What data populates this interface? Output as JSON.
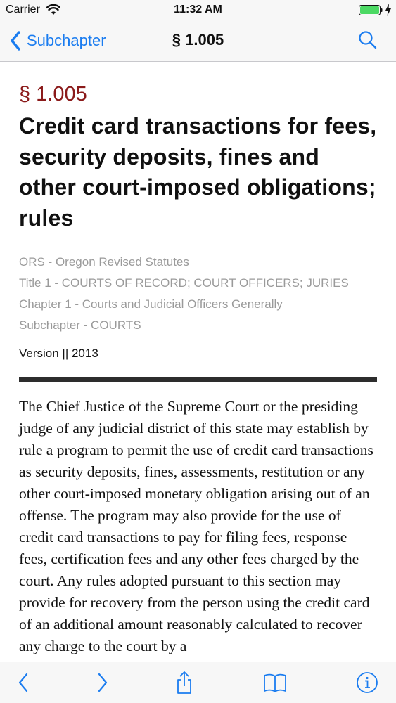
{
  "status_bar": {
    "carrier": "Carrier",
    "time": "11:32 AM"
  },
  "nav": {
    "back_label": "Subchapter",
    "title": "§ 1.005",
    "accent_color": "#1a7cf0"
  },
  "section": {
    "number": "§ 1.005",
    "title": "Credit card transactions for fees, security deposits, fines and other court-imposed obligations; rules",
    "number_color": "#8b1a1a"
  },
  "meta": {
    "lines": [
      "ORS - Oregon Revised Statutes",
      "Title 1 - COURTS OF RECORD; COURT OFFICERS; JURIES",
      "Chapter 1 - Courts and Judicial Officers Generally",
      "Subchapter - COURTS"
    ],
    "version": "Version || 2013"
  },
  "body": {
    "text": "The Chief Justice of the Supreme Court or the presiding judge of any judicial district of this state may establish by rule a program to permit the use of credit card transactions as security deposits, fines, assessments, restitution or any other court-imposed monetary obligation arising out of an offense. The program may also provide for the use of credit card transactions to pay for filing fees, response fees, certification fees and any other fees charged by the court. Any rules adopted pursuant to this section may provide for recovery from the person using the credit card of an additional amount reasonably calculated to recover any charge to the court by a"
  },
  "toolbar": {
    "icons": [
      "chevron-left-icon",
      "chevron-right-icon",
      "share-icon",
      "book-icon",
      "info-icon"
    ]
  }
}
